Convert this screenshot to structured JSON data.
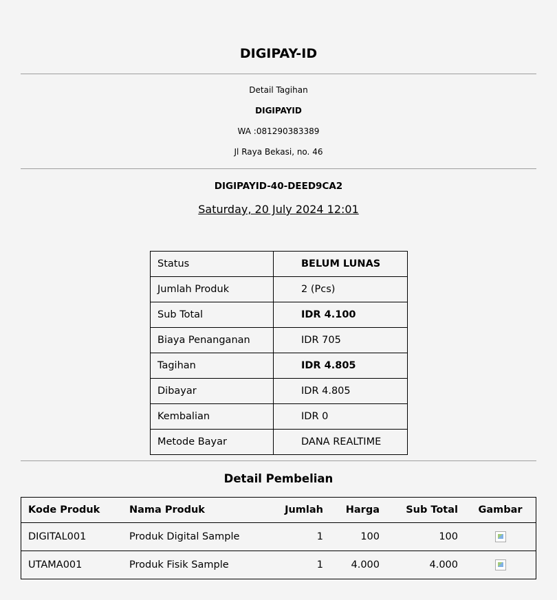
{
  "header": {
    "title": "DIGIPAY-ID",
    "subtitle": "Detail Tagihan",
    "merchant_name": "DIGIPAYID",
    "phone": "WA :081290383389",
    "address": "Jl Raya Bekasi, no. 46"
  },
  "invoice": {
    "id": "DIGIPAYID-40-DEED9CA2",
    "date": "Saturday, 20 July 2024 12:01"
  },
  "summary": [
    {
      "label": "Status",
      "value": "BELUM LUNAS",
      "bold": true
    },
    {
      "label": "Jumlah Produk",
      "value": "2 (Pcs)",
      "bold": false
    },
    {
      "label": "Sub Total",
      "value": "IDR 4.100",
      "bold": true
    },
    {
      "label": "Biaya Penanganan",
      "value": "IDR 705",
      "bold": false
    },
    {
      "label": "Tagihan",
      "value": "IDR 4.805",
      "bold": true
    },
    {
      "label": "Dibayar",
      "value": "IDR 4.805",
      "bold": false
    },
    {
      "label": "Kembalian",
      "value": "IDR 0",
      "bold": false
    },
    {
      "label": "Metode Bayar",
      "value": "DANA REALTIME",
      "bold": false
    }
  ],
  "purchase": {
    "title": "Detail Pembelian",
    "columns": [
      "Kode Produk",
      "Nama Produk",
      "Jumlah",
      "Harga",
      "Sub Total",
      "Gambar"
    ],
    "rows": [
      {
        "code": "DIGITAL001",
        "name": "Produk Digital Sample",
        "qty": "1",
        "price": "100",
        "subtotal": "100",
        "image": "broken-image-icon"
      },
      {
        "code": "UTAMA001",
        "name": "Produk Fisik Sample",
        "qty": "1",
        "price": "4.000",
        "subtotal": "4.000",
        "image": "broken-image-icon"
      }
    ]
  }
}
